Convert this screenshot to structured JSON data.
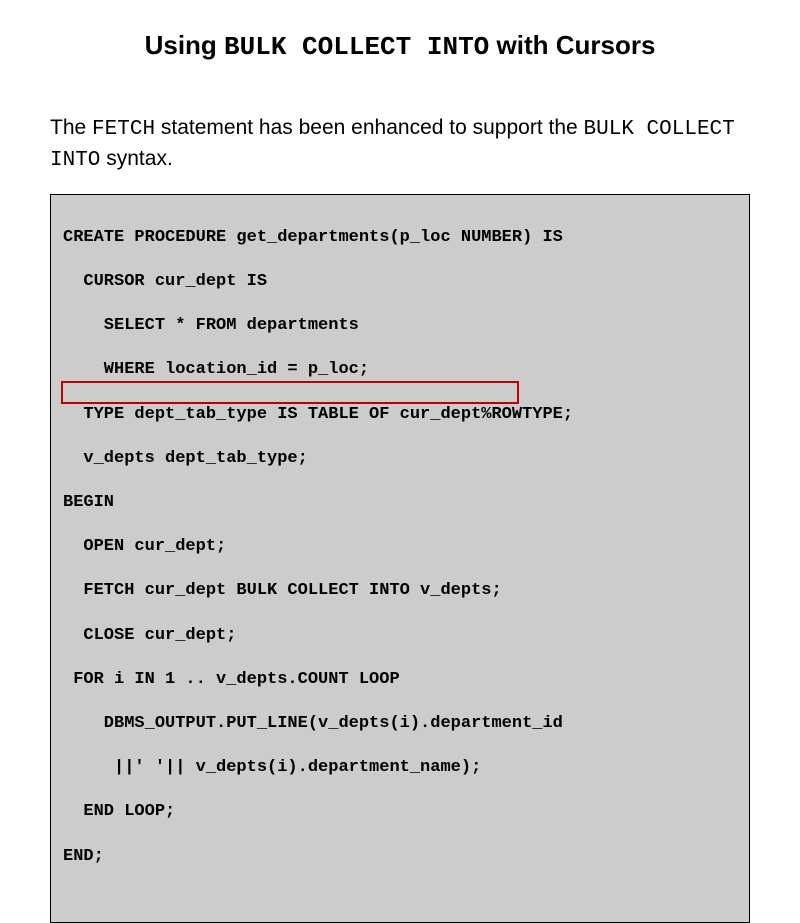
{
  "title": {
    "prefix": "Using ",
    "mono": "BULK COLLECT INTO",
    "suffix": " with Cursors"
  },
  "body": {
    "t1": "The ",
    "m1": "FETCH",
    "t2": " statement has been enhanced to support the ",
    "m2": "BULK COLLECT INTO",
    "t3": " syntax."
  },
  "code": {
    "l1": "CREATE PROCEDURE get_departments(p_loc NUMBER) IS",
    "l2": "  CURSOR cur_dept IS",
    "l3": "    SELECT * FROM departments",
    "l4": "    WHERE location_id = p_loc;",
    "l5": "  TYPE dept_tab_type IS TABLE OF cur_dept%ROWTYPE;",
    "l6": "  v_depts dept_tab_type;",
    "l7": "BEGIN",
    "l8": "  OPEN cur_dept;",
    "l9": "  FETCH cur_dept BULK COLLECT INTO v_depts;",
    "l10": "  CLOSE cur_dept;",
    "l11": " FOR i IN 1 .. v_depts.COUNT LOOP",
    "l12": "    DBMS_OUTPUT.PUT_LINE(v_depts(i).department_id",
    "l13": "     ||' '|| v_depts(i).department_name);",
    "l14": "  END LOOP;",
    "l15": "END;"
  }
}
